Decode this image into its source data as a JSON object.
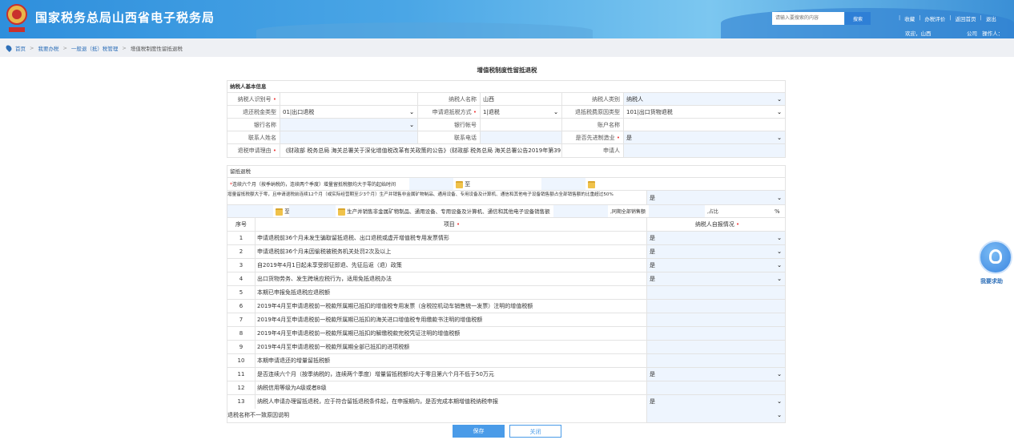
{
  "header": {
    "site_title": "国家税务总局山西省电子税务局",
    "search_placeholder": "请输入要搜索的内容",
    "search_button": "搜索",
    "links": [
      "收藏",
      "办税评价",
      "返回首页",
      "退出"
    ],
    "welcome": "欢迎，山西",
    "company": "公司",
    "operator": "操作人："
  },
  "breadcrumb": [
    "首页",
    "我要办税",
    "一般退（抵）税管理",
    "增值税制度性留抵退税"
  ],
  "page_title": "增值税制度性留抵退税",
  "basic": {
    "title": "纳税人基本信息",
    "taxpayer_id_label": "纳税人识别号",
    "taxpayer_id": "",
    "taxpayer_name_label": "纳税人名称",
    "taxpayer_name": "山西",
    "taxpayer_type_label": "纳税人类别",
    "taxpayer_type": "纳税人",
    "refund_tax_type_label": "退还税金类型",
    "refund_tax_type": "01|出口退税",
    "apply_method_label": "申请退抵税方式",
    "apply_method": "1|退税",
    "refund_source_label": "退抵税费原因类型",
    "refund_source": "101|出口货物退税",
    "bank_name_label": "银行名称",
    "bank_name": "",
    "bank_account_label": "银行帐号",
    "bank_account": "",
    "account_name_label": "账户名称",
    "account_name": "",
    "contact_label": "联系人姓名",
    "contact": "",
    "phone_label": "联系电话",
    "phone": "",
    "advanced_mfg_label": "是否先进制造业",
    "advanced_mfg": "是",
    "reason_label": "退税申请理由",
    "reason": "《财政部 税务总局 海关总署关于深化增值税改革有关政策的公告》（财政部 税务总局 海关总署公告2019年第39",
    "applicant_label": "申请人",
    "applicant": ""
  },
  "retain": {
    "title": "留抵退税",
    "start_label": "连续六个月（按季纳税的，连续两个季度）增量留抵税额均大于零的起始时间",
    "to": "至",
    "ratio_question": "增量留抵税额大于零，且申请退税前连续12个月（或实际经营期至少3个月）生产并销售非金属矿物制品、通用设备、专用设备及计算机、通信和其他电子设备销售额占全部销售额的比重超过50%",
    "ratio_answer": "是",
    "sales_label": "生产并销售非金属矿物制品、通用设备、专用设备及计算机、通信和其他电子设备销售额",
    "total_label": ",同期全部销售额",
    "pct_label": ",占比",
    "pct_unit": "%"
  },
  "table": {
    "col_no": "序号",
    "col_item": "项目",
    "col_answer": "纳税人自报情况",
    "rows": [
      {
        "no": "1",
        "item": "申请退税前36个月未发生骗取留抵退税、出口退税或虚开增值税专用发票情形",
        "answer": "是"
      },
      {
        "no": "2",
        "item": "申请退税前36个月未因偷税被税务机关处罚2次及以上",
        "answer": "是"
      },
      {
        "no": "3",
        "item": "自2019年4月1日起未享受即征即退、先征后返（退）政策",
        "answer": "是"
      },
      {
        "no": "4",
        "item": "出口货物劳务、发生跨境应税行为，适用免抵退税办法",
        "answer": "是"
      },
      {
        "no": "5",
        "item": "本期已申报免抵退税应退税额",
        "answer": ""
      },
      {
        "no": "6",
        "item": "2019年4月至申请退税前一税款所属期已抵扣的增值税专用发票（含税控机动车销售统一发票）注明的增值税额",
        "answer": ""
      },
      {
        "no": "7",
        "item": "2019年4月至申请退税前一税款所属期已抵扣的海关进口增值税专用缴款书注明的增值税额",
        "answer": ""
      },
      {
        "no": "8",
        "item": "2019年4月至申请退税前一税款所属期已抵扣的解缴税款完税凭证注明的增值税额",
        "answer": ""
      },
      {
        "no": "9",
        "item": "2019年4月至申请退税前一税款所属期全部已抵扣的进项税额",
        "answer": ""
      },
      {
        "no": "10",
        "item": "本期申请退还的增量留抵税额",
        "answer": ""
      },
      {
        "no": "11",
        "item": "是否连续六个月（按季纳税的，连续两个季度）增量留抵税额均大于零且第六个月不低于50万元",
        "answer": "是"
      },
      {
        "no": "12",
        "item": "纳税信用等级为A级或者B级",
        "answer": ""
      },
      {
        "no": "13",
        "item": "纳税人申请办理留抵退税，应于符合留抵退税条件起，在申报期内，是否完成本期增值税纳税申报",
        "answer": "是"
      }
    ],
    "mismatch_label": "退税名称不一致原因说明",
    "mismatch_value": ""
  },
  "buttons": {
    "save": "保存",
    "close": "关闭"
  },
  "help": "我要求助"
}
